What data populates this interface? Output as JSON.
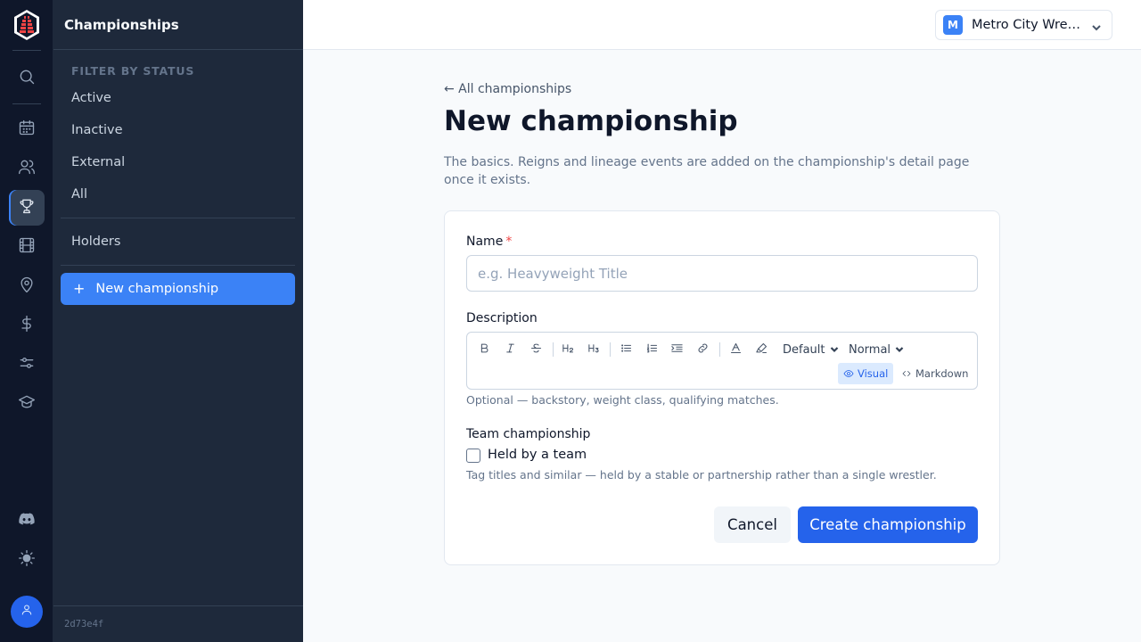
{
  "app": {
    "logo_icon": "tower-logo-icon",
    "accent_color": "#3b82f6",
    "version": "2d73e4f"
  },
  "rail": {
    "items": [
      {
        "icon": "search-icon"
      },
      {
        "icon": "calendar-icon"
      },
      {
        "icon": "users-icon"
      },
      {
        "icon": "trophy-icon",
        "active": true
      },
      {
        "icon": "film-icon"
      },
      {
        "icon": "map-pin-icon"
      },
      {
        "icon": "dollar-icon"
      },
      {
        "icon": "sliders-icon"
      },
      {
        "icon": "graduation-cap-icon"
      },
      {
        "icon": "discord-icon"
      },
      {
        "icon": "sun-icon"
      }
    ],
    "avatar_icon": "user-icon"
  },
  "sidebar": {
    "title": "Championships",
    "section_label": "FILTER BY STATUS",
    "filters": [
      "Active",
      "Inactive",
      "External",
      "All"
    ],
    "holders_label": "Holders",
    "new_button_label": "New championship"
  },
  "topbar": {
    "org_initial": "M",
    "org_name": "Metro City Wrestling"
  },
  "page": {
    "back_link": "← All championships",
    "title": "New championship",
    "description": "The basics. Reigns and lineage events are added on the championship's detail page once it exists."
  },
  "form": {
    "name_label": "Name",
    "name_required_mark": "*",
    "name_placeholder": "e.g. Heavyweight Title",
    "name_value": "",
    "description_label": "Description",
    "editor": {
      "font_select": "Default",
      "size_select": "Normal",
      "mode_visual": "Visual",
      "mode_markdown": "Markdown",
      "active_mode": "Visual"
    },
    "description_helper": "Optional — backstory, weight class, qualifying matches.",
    "team_label": "Team championship",
    "team_checkbox_label": "Held by a team",
    "team_checked": false,
    "team_helper": "Tag titles and similar — held by a stable or partnership rather than a single wrestler.",
    "cancel_label": "Cancel",
    "submit_label": "Create championship"
  }
}
